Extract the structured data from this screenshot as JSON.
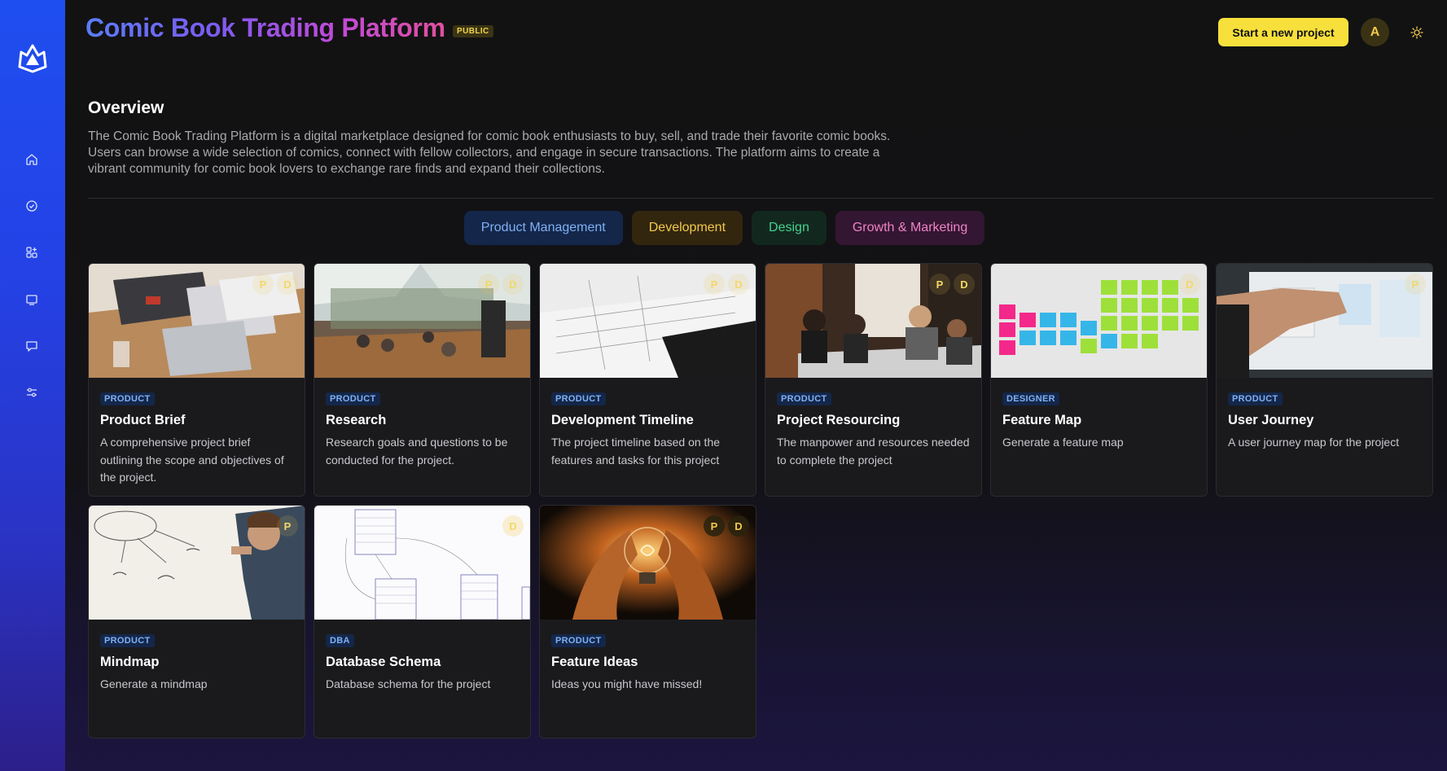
{
  "app": {
    "title": "Comic Book Trading Platform",
    "visibility_badge": "PUBLIC",
    "accent_color": "#f7e03c",
    "sidebar_color": "#1f4ef0"
  },
  "header": {
    "start_button_label": "Start a new project",
    "avatar_initial": "A"
  },
  "sidebar": {
    "items": [
      {
        "icon": "home-icon"
      },
      {
        "icon": "check-circle-icon"
      },
      {
        "icon": "apps-icon"
      },
      {
        "icon": "monitor-icon"
      },
      {
        "icon": "chat-icon"
      },
      {
        "icon": "sliders-icon"
      }
    ]
  },
  "overview": {
    "title": "Overview",
    "text": "The Comic Book Trading Platform is a digital marketplace designed for comic book enthusiasts to buy, sell, and trade their favorite comic books. Users can browse a wide selection of comics, connect with fellow collectors, and engage in secure transactions. The platform aims to create a vibrant community for comic book lovers to exchange rare finds and expand their collections."
  },
  "filters": [
    {
      "label": "Product Management",
      "color": "#7fb0f5"
    },
    {
      "label": "Development",
      "color": "#f2c94c"
    },
    {
      "label": "Design",
      "color": "#49d18e"
    },
    {
      "label": "Growth & Marketing",
      "color": "#ee82c8"
    }
  ],
  "cards": [
    {
      "tag": "PRODUCT",
      "title": "Product Brief",
      "desc": "A comprehensive project brief outlining the scope and objectives of the project.",
      "roles": [
        "P",
        "D"
      ],
      "image": "desk-with-laptop"
    },
    {
      "tag": "PRODUCT",
      "title": "Research",
      "desc": "Research goals and questions to be conducted for the project.",
      "roles": [
        "P",
        "D"
      ],
      "image": "open-office"
    },
    {
      "tag": "PRODUCT",
      "title": "Development Timeline",
      "desc": "The project timeline based on the features and tasks for this project",
      "roles": [
        "P",
        "D"
      ],
      "image": "open-planner"
    },
    {
      "tag": "PRODUCT",
      "title": "Project Resourcing",
      "desc": "The manpower and resources needed to complete the project",
      "roles": [
        "P",
        "D"
      ],
      "image": "team-meeting"
    },
    {
      "tag": "DESIGNER",
      "title": "Feature Map",
      "desc": "Generate a feature map",
      "roles": [
        "D"
      ],
      "image": "sticky-notes-wall"
    },
    {
      "tag": "PRODUCT",
      "title": "User Journey",
      "desc": "A user journey map for the project",
      "roles": [
        "P"
      ],
      "image": "whiteboard-hand"
    },
    {
      "tag": "PRODUCT",
      "title": "Mindmap",
      "desc": "Generate a mindmap",
      "roles": [
        "P"
      ],
      "image": "whiteboard-sketch"
    },
    {
      "tag": "DBA",
      "title": "Database Schema",
      "desc": "Database schema for the project",
      "roles": [
        "D"
      ],
      "image": "schema-diagram"
    },
    {
      "tag": "PRODUCT",
      "title": "Feature Ideas",
      "desc": "Ideas you might have missed!",
      "roles": [
        "P",
        "D"
      ],
      "image": "lightbulb-hands"
    }
  ]
}
